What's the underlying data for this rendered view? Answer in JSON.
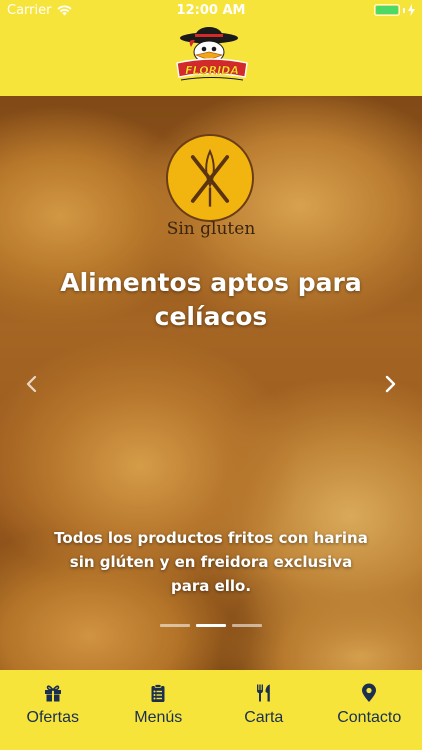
{
  "status": {
    "carrier": "Carrier",
    "time": "12:00 AM"
  },
  "header": {
    "logo_text": "FLORIDA"
  },
  "hero": {
    "badge_caption": "Sin gluten",
    "title": "Alimentos aptos para celíacos",
    "description": "Todos los productos fritos con harina sin glúten y en freidora exclusiva para ello.",
    "slides_total": 3,
    "slide_active_index": 1
  },
  "tabs": [
    {
      "label": "Ofertas",
      "icon": "gift-icon"
    },
    {
      "label": "Menús",
      "icon": "clipboard-list-icon"
    },
    {
      "label": "Carta",
      "icon": "utensils-icon"
    },
    {
      "label": "Contacto",
      "icon": "map-pin-icon"
    }
  ],
  "colors": {
    "brand_yellow": "#f7e43b",
    "tab_text": "#1b2f4f",
    "battery_green": "#4cd964"
  }
}
